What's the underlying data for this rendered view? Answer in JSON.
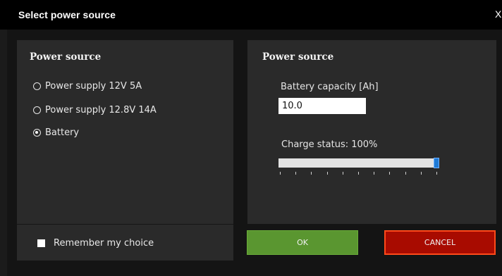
{
  "window": {
    "title": "Select power source",
    "close_label": "X"
  },
  "left_panel": {
    "title": "Power source",
    "options": [
      {
        "label": "Power supply 12V 5A",
        "selected": false
      },
      {
        "label": "Power supply 12.8V 14A",
        "selected": false
      },
      {
        "label": "Battery",
        "selected": true
      }
    ],
    "remember_label": "Remember my choice"
  },
  "right_panel": {
    "title": "Power source",
    "capacity_label": "Battery capacity [Ah]",
    "capacity_value": "10.0",
    "charge_label": "Charge status: 100%",
    "charge_percent": 100
  },
  "buttons": {
    "ok_label": "OK",
    "cancel_label": "CANCEL"
  },
  "colors": {
    "ok": "#5a9630",
    "cancel": "#a80b00",
    "cancel_border": "#ff4a1a",
    "slider_thumb": "#1e7ad6"
  }
}
